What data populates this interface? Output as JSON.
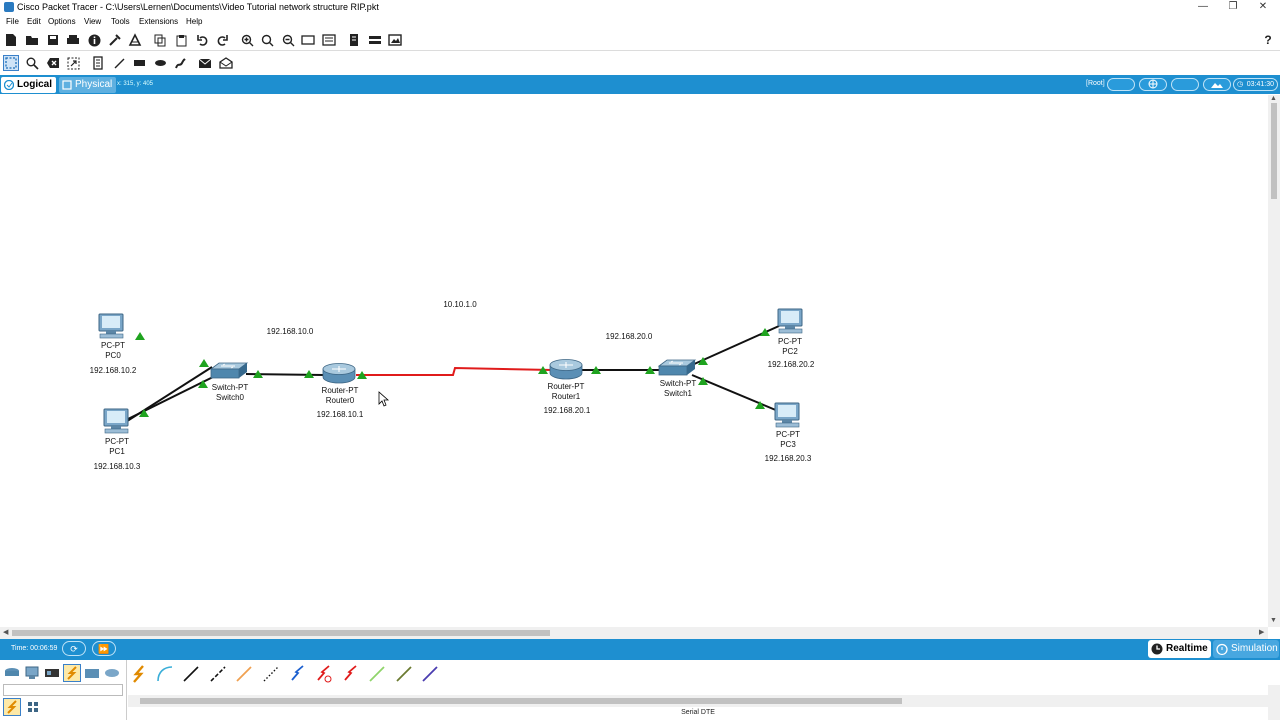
{
  "window": {
    "title": "Cisco Packet Tracer - C:\\Users\\Lernen\\Documents\\Video Tutorial network structure RIP.pkt",
    "help_glyph": "?"
  },
  "menu": [
    "File",
    "Edit",
    "Options",
    "View",
    "Tools",
    "Extensions",
    "Help"
  ],
  "view": {
    "logical_label": "Logical",
    "physical_label": "Physical",
    "coords": "x: 315, y: 405",
    "root_label": "[Root]",
    "clock": "03:41:30"
  },
  "networks": {
    "lan_left": "192.168.10.0",
    "wan": "10.10.1.0",
    "lan_right": "192.168.20.0"
  },
  "devices": {
    "pc0": {
      "model": "PC-PT",
      "name": "PC0",
      "ip": "192.168.10.2"
    },
    "pc1": {
      "model": "PC-PT",
      "name": "PC1",
      "ip": "192.168.10.3"
    },
    "switch0": {
      "model": "Switch-PT",
      "name": "Switch0"
    },
    "router0": {
      "model": "Router-PT",
      "name": "Router0",
      "ip": "192.168.10.1"
    },
    "router1": {
      "model": "Router-PT",
      "name": "Router1",
      "ip": "192.168.20.1"
    },
    "switch1": {
      "model": "Switch-PT",
      "name": "Switch1"
    },
    "pc2": {
      "model": "PC-PT",
      "name": "PC2",
      "ip": "192.168.20.2"
    },
    "pc3": {
      "model": "PC-PT",
      "name": "PC3",
      "ip": "192.168.20.3"
    }
  },
  "bottom": {
    "time": "Time: 00:06:59",
    "realtime_label": "Realtime",
    "simulation_label": "Simulation",
    "status_text": "Serial DTE"
  },
  "colors": {
    "accent_blue": "#1e8fd0",
    "link_green": "#1fa31f",
    "serial_red": "#e01b1b",
    "copper_black": "#111111"
  }
}
